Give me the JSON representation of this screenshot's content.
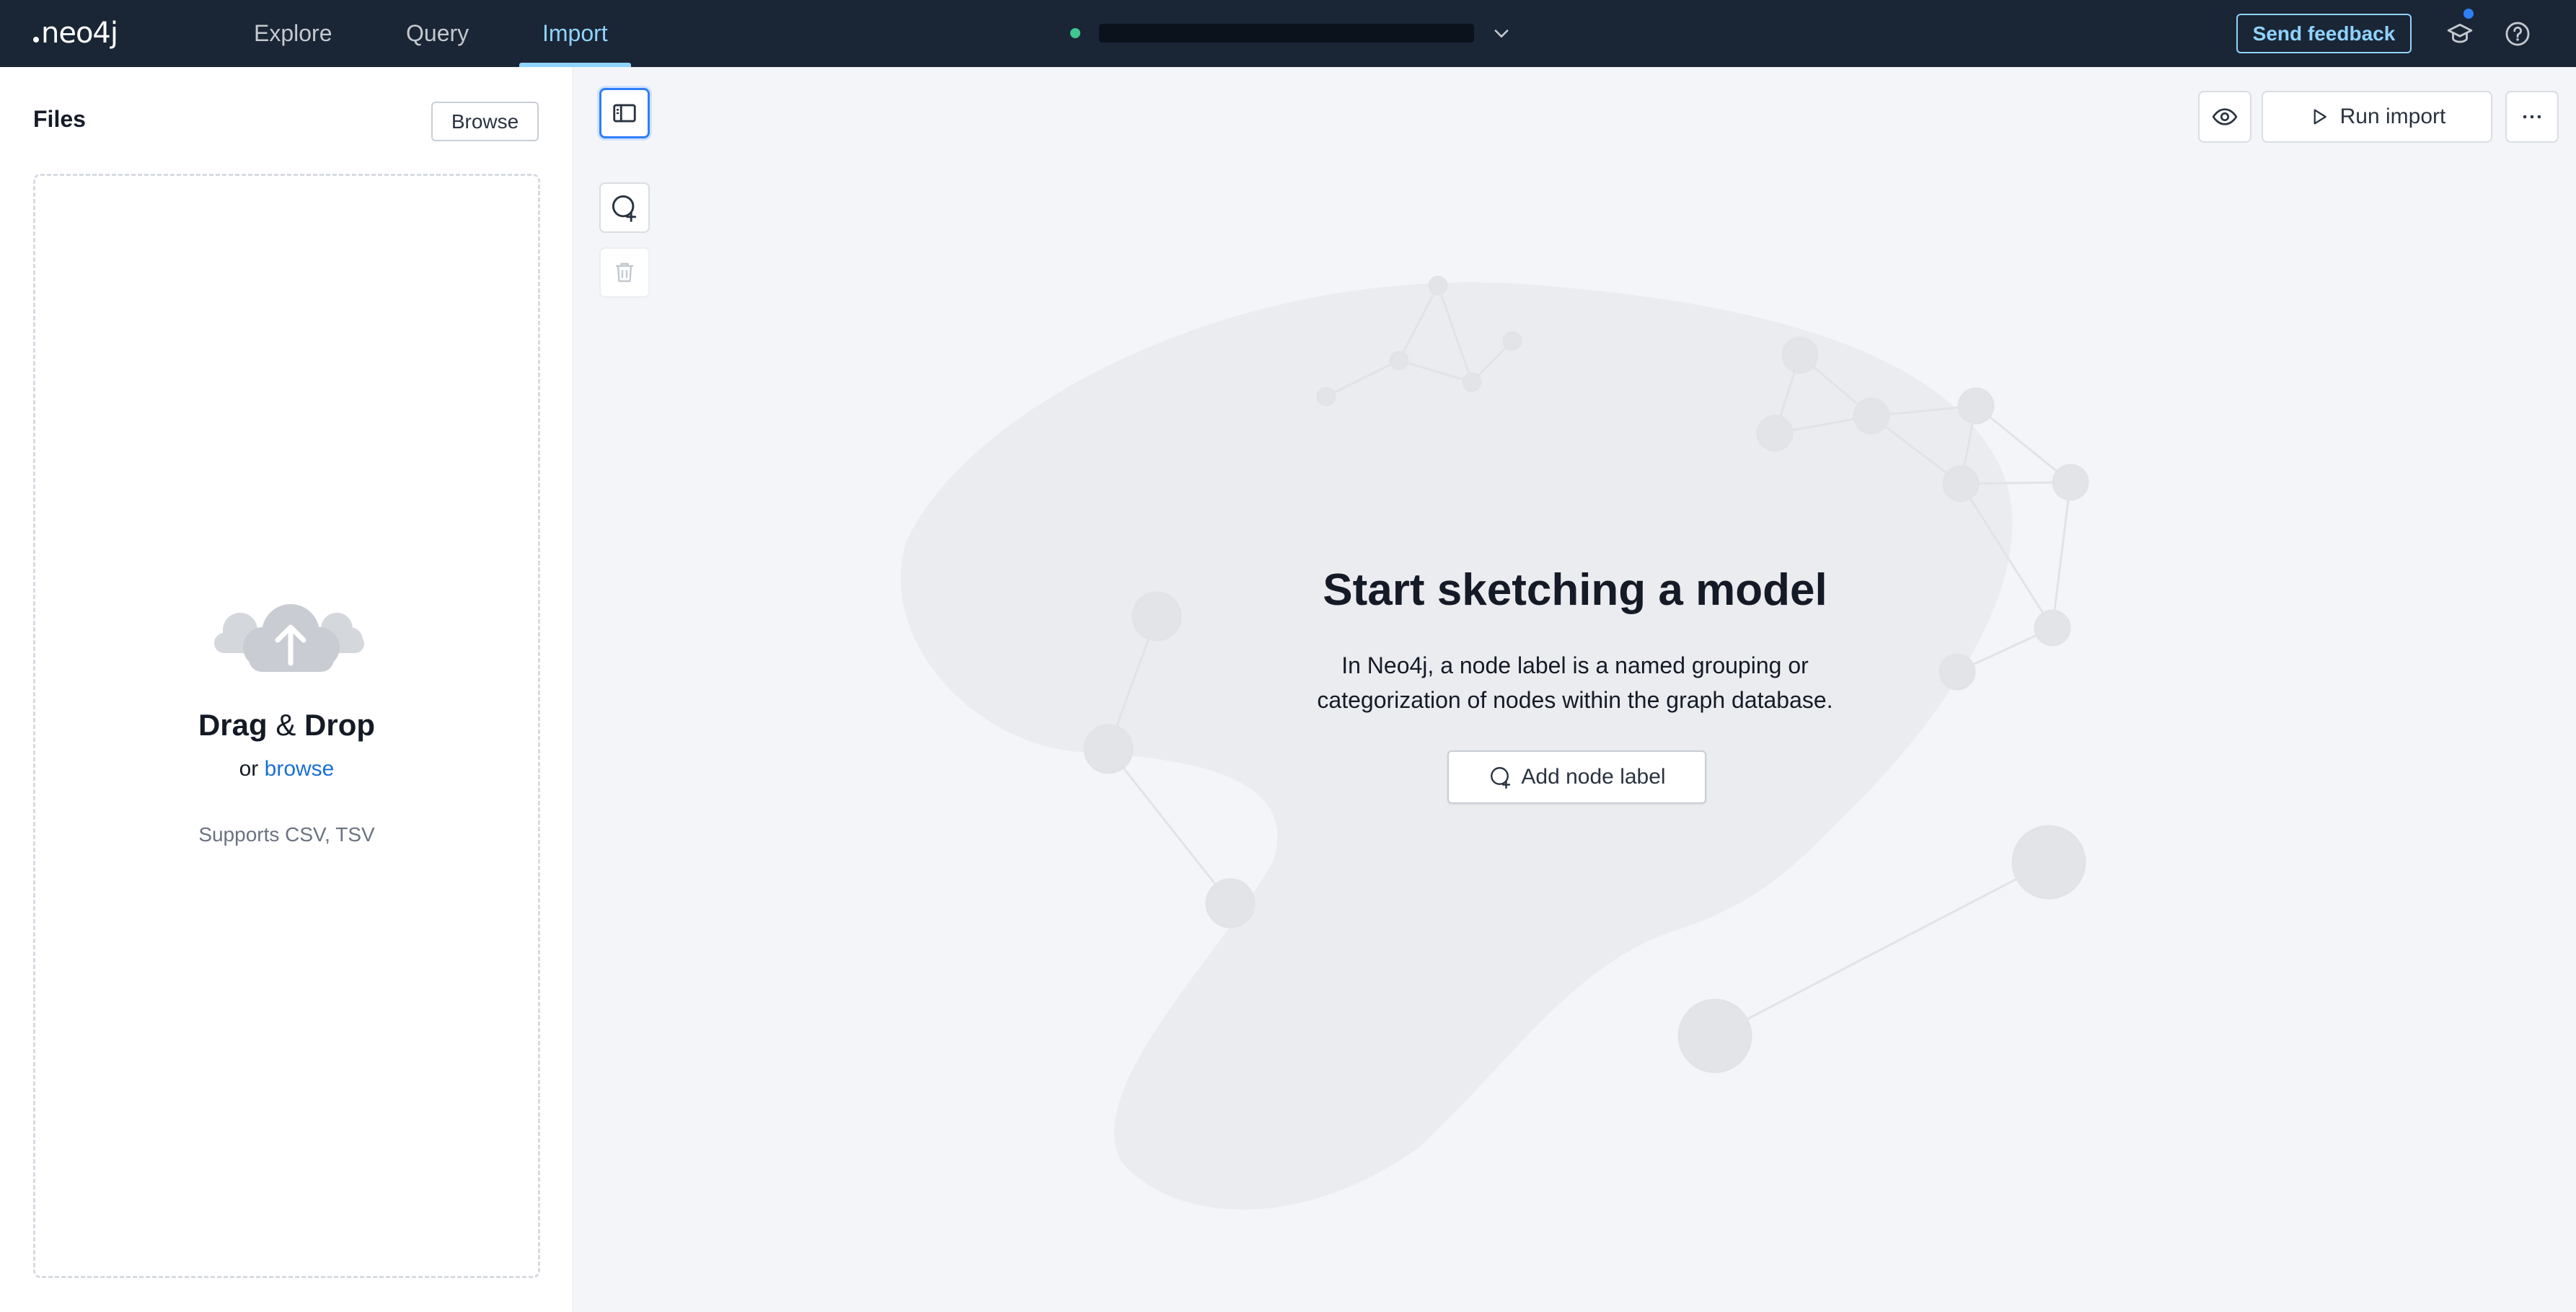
{
  "topbar": {
    "logo_text": "neo4j",
    "tabs": [
      {
        "label": "Explore",
        "active": false
      },
      {
        "label": "Query",
        "active": false
      },
      {
        "label": "Import",
        "active": true
      }
    ],
    "connection": {
      "status_color": "#3ec78e",
      "name_redacted": true
    },
    "send_feedback_label": "Send feedback",
    "icons": [
      "learn-icon",
      "help-icon"
    ],
    "accent_color": "#8fd3ff"
  },
  "files": {
    "title": "Files",
    "browse_label": "Browse",
    "dropzone": {
      "title_drag": "Drag",
      "title_amp": "&",
      "title_drop": "Drop",
      "or_text": "or",
      "browse_link": "browse",
      "supports": "Supports CSV, TSV"
    }
  },
  "canvas": {
    "toolbar": [
      "toggle-sidebar-icon",
      "add-node-icon",
      "delete-icon"
    ],
    "preview_icon": "eye-icon",
    "run_import_label": "Run import",
    "more_icon": "more-horizontal-icon",
    "empty_state": {
      "title": "Start sketching a model",
      "description_line1": "In Neo4j, a node label is a named grouping or",
      "description_line2": "categorization of nodes within the graph database.",
      "add_node_label": "Add node label"
    }
  }
}
